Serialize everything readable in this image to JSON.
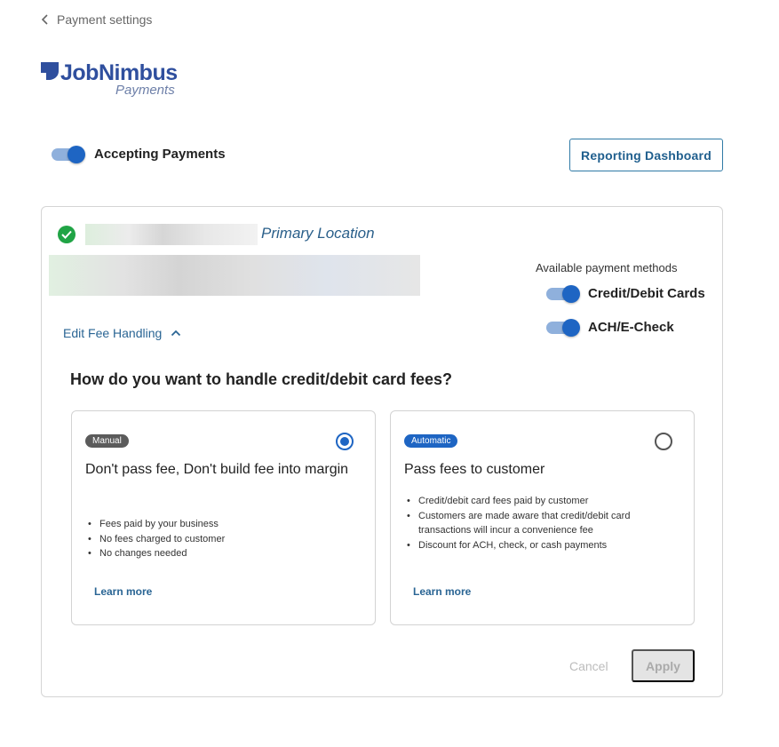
{
  "nav": {
    "back_label": "Payment settings"
  },
  "logo": {
    "name": "JobNimbus",
    "sub": "Payments"
  },
  "header": {
    "accepting_label": "Accepting Payments",
    "accepting_on": true,
    "reporting_button": "Reporting Dashboard"
  },
  "location": {
    "primary_label": "Primary Location",
    "verified": true
  },
  "payment_methods": {
    "title": "Available payment methods",
    "items": [
      {
        "label": "Credit/Debit Cards",
        "enabled": true
      },
      {
        "label": "ACH/E-Check",
        "enabled": true
      }
    ]
  },
  "fee_handling": {
    "toggle_label": "Edit Fee Handling",
    "question": "How do you want to handle credit/debit card fees?",
    "options": [
      {
        "badge": "Manual",
        "title": "Don't pass fee, Don't build fee into margin",
        "selected": true,
        "bullets": [
          "Fees paid by your business",
          "No fees charged to customer",
          "No changes needed"
        ],
        "learn_more": "Learn more"
      },
      {
        "badge": "Automatic",
        "title": "Pass fees to customer",
        "selected": false,
        "bullets": [
          "Credit/debit card fees paid by customer",
          "Customers are made aware that credit/debit card transactions will incur a convenience fee",
          "Discount for ACH, check, or cash payments"
        ],
        "learn_more": "Learn more"
      }
    ],
    "cancel_label": "Cancel",
    "apply_label": "Apply"
  },
  "colors": {
    "accent": "#1e65c3",
    "link": "#2a6594",
    "success": "#20a445",
    "brand": "#2f4f9e"
  },
  "icons": [
    "chevron-left-icon",
    "check-circle-icon",
    "chevron-up-icon",
    "logo-mark-icon"
  ]
}
